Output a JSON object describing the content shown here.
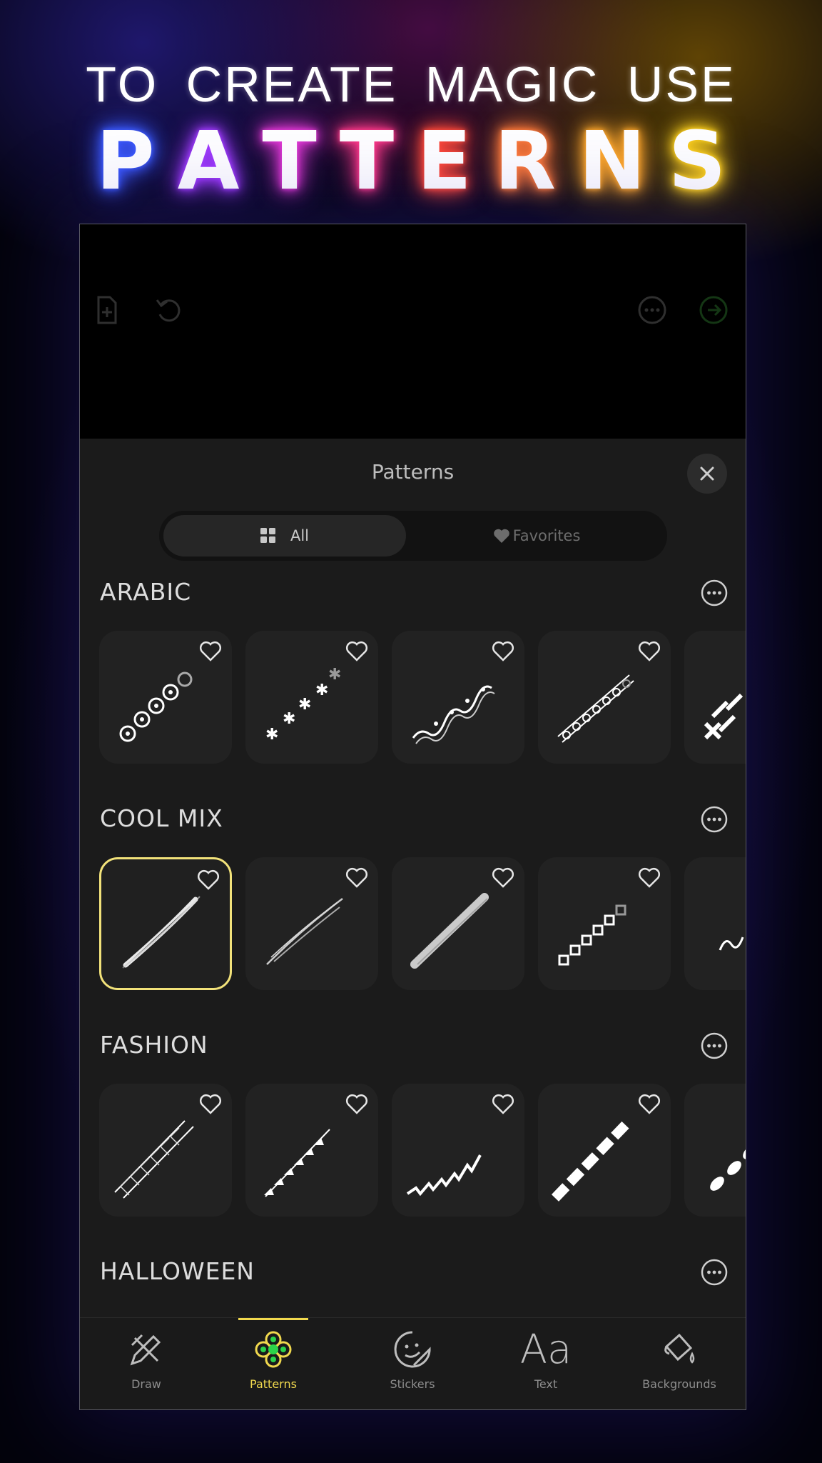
{
  "promo": {
    "headline_words": [
      "TO",
      "CREATE",
      "MAGIC",
      "USE"
    ],
    "brand_letters": [
      "P",
      "A",
      "T",
      "T",
      "E",
      "R",
      "N",
      "S"
    ],
    "brand_colors": [
      "#3d5bff",
      "#a23cff",
      "#e53ad8",
      "#ff3a8a",
      "#ff4a3a",
      "#ff7a3a",
      "#ffa82c",
      "#ffd21e"
    ]
  },
  "canvas_toolbar": {
    "icons": [
      "new-file-icon",
      "undo-icon",
      "more-options-icon",
      "next-arrow-icon"
    ]
  },
  "sheet": {
    "title": "Patterns",
    "close_icon": "close-icon",
    "tabs": [
      {
        "label": "All",
        "icon": "grid-icon",
        "active": true
      },
      {
        "label": "Favorites",
        "icon": "heart-icon",
        "active": false
      }
    ]
  },
  "sections": [
    {
      "title": "ARABIC",
      "tiles": [
        "flower-chain",
        "star-flowers",
        "wave-dots",
        "swirl-band",
        "chevron-block"
      ]
    },
    {
      "title": "COOL MIX",
      "tiles": [
        "glow-streak",
        "split-streak",
        "brush-streak",
        "diamond-chain",
        "squiggle"
      ],
      "selected_index": 0
    },
    {
      "title": "FASHION",
      "tiles": [
        "lattice-tape",
        "arrow-beads",
        "zigzag-ribbon",
        "dash-ribbon",
        "leaf-drops"
      ]
    },
    {
      "title": "HALLOWEEN",
      "tiles": []
    }
  ],
  "nav": {
    "items": [
      {
        "label": "Draw",
        "icon": "draw-icon",
        "active": false
      },
      {
        "label": "Patterns",
        "icon": "patterns-icon",
        "active": true
      },
      {
        "label": "Stickers",
        "icon": "stickers-icon",
        "active": false
      },
      {
        "label": "Text",
        "icon": "text-icon",
        "active": false,
        "glyph": "Aa"
      },
      {
        "label": "Backgrounds",
        "icon": "backgrounds-icon",
        "active": false
      }
    ],
    "active_color": "#f1d94e"
  }
}
